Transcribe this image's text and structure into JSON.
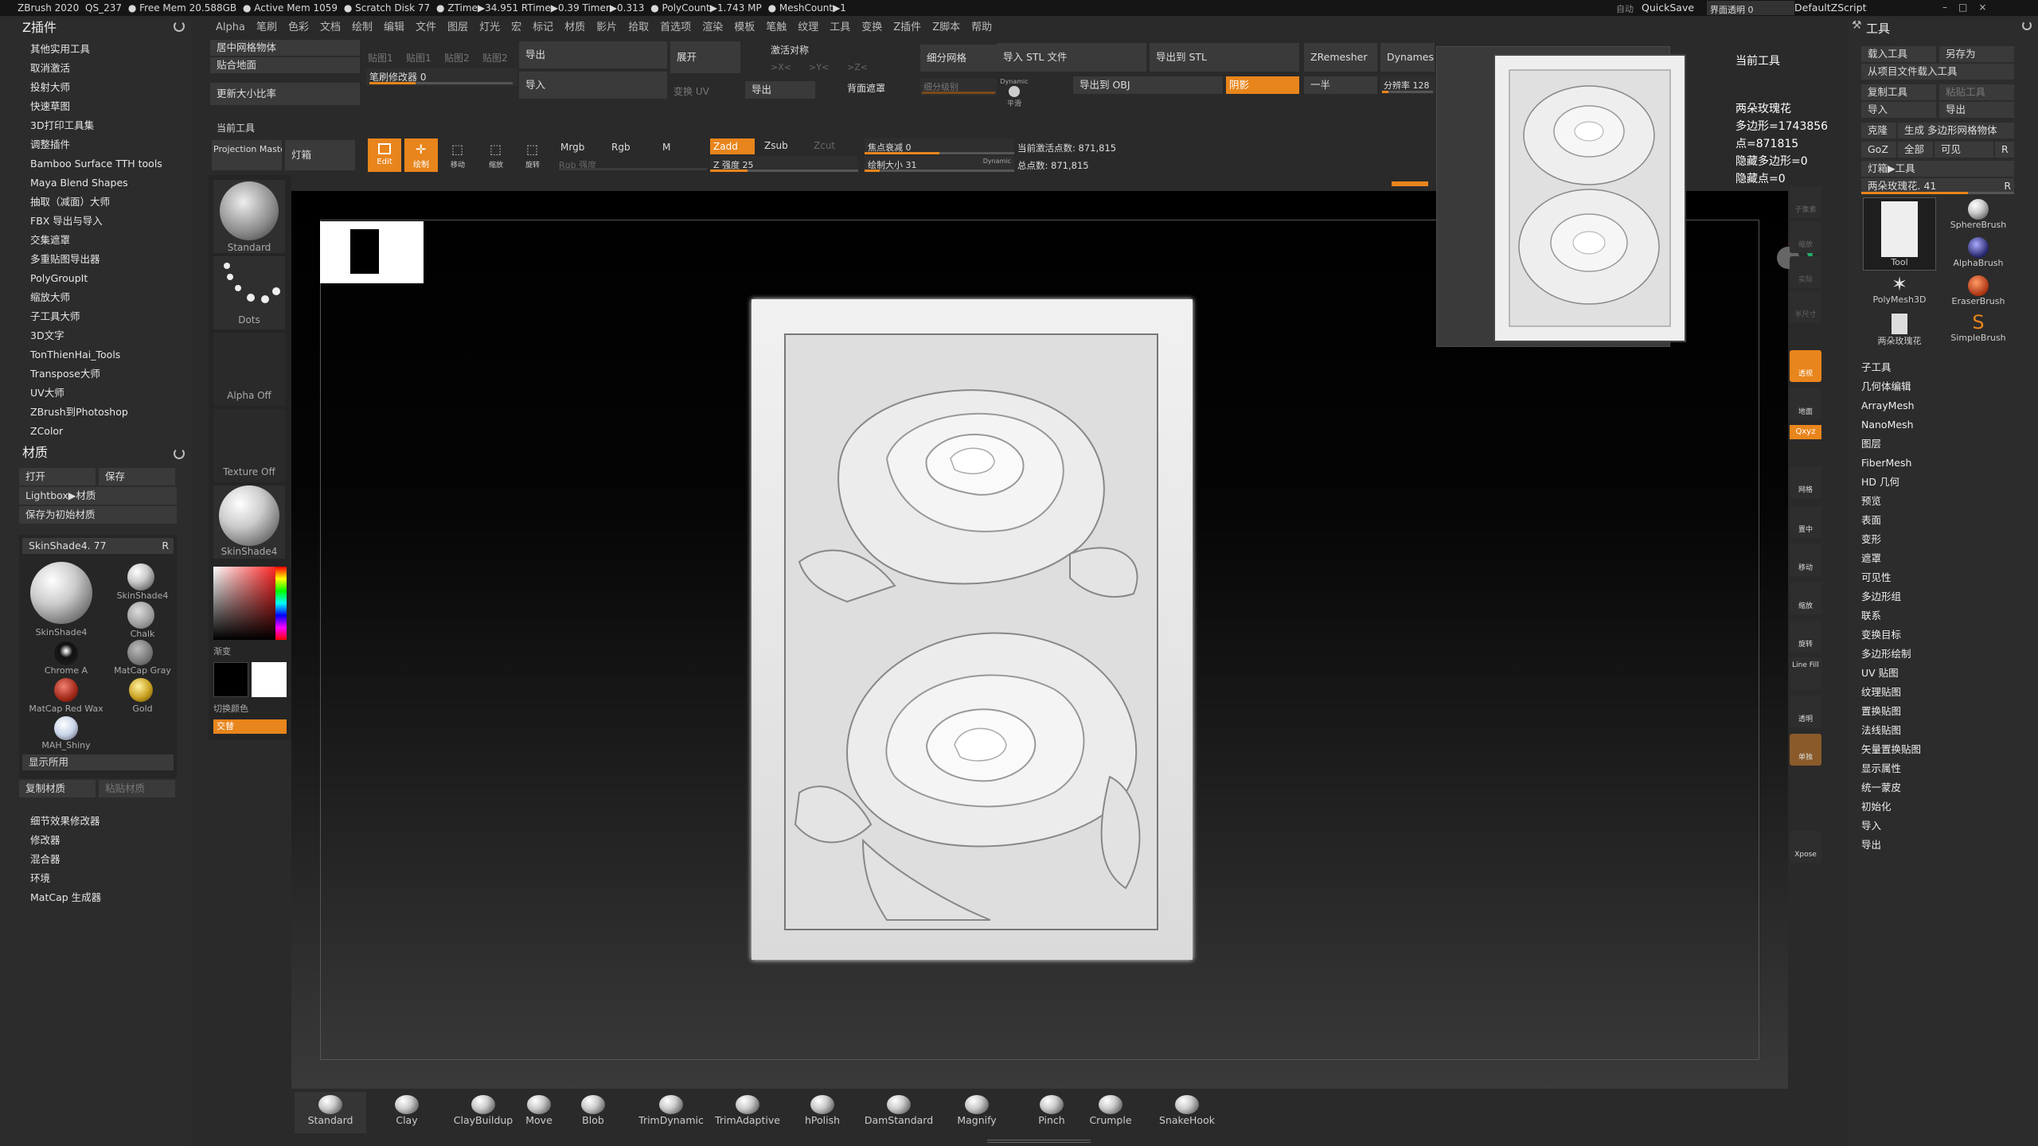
{
  "titlebar": {
    "items": [
      "ZBrush 2020",
      "QS_237",
      "● Free Mem 20.588GB",
      "● Active Mem 1059",
      "● Scratch Disk 77",
      "● ZTime▶34.951 RTime▶0.39 Timer▶0.313",
      "● PolyCount▶1.743 MP",
      "● MeshCount▶1"
    ],
    "auto": "自动",
    "quicksave": "QuickSave",
    "transparency": "界面透明 0",
    "script": "DefaultZScript"
  },
  "menu": [
    "Alpha",
    "笔刷",
    "色彩",
    "文档",
    "绘制",
    "编辑",
    "文件",
    "图层",
    "灯光",
    "宏",
    "标记",
    "材质",
    "影片",
    "拾取",
    "首选项",
    "渲染",
    "模板",
    "笔触",
    "纹理",
    "工具",
    "变换",
    "Z插件",
    "Z脚本",
    "帮助"
  ],
  "left": {
    "zplugin_title": "Z插件",
    "plugins": [
      "其他实用工具",
      "取消激活",
      "投射大师",
      "快速草图",
      "3D打印工具集",
      "调整插件",
      "Bamboo Surface TTH tools",
      "Maya Blend Shapes",
      "抽取（减面）大师",
      "FBX 导出与导入",
      "交集遮罩",
      "多重贴图导出器",
      "PolyGroupIt",
      "缩放大师",
      "子工具大师",
      "3D文字",
      "TonThienHai_Tools",
      "Transpose大师",
      "UV大师",
      "ZBrush到Photoshop",
      "ZColor"
    ],
    "material_title": "材质",
    "open": "打开",
    "save": "保存",
    "lightbox": "Lightbox▶材质",
    "save_init": "保存为初始材质",
    "current_mat": "SkinShade4. 77",
    "r": "R",
    "materials": [
      "SkinShade4",
      "Chalk",
      "Chrome A",
      "MatCap Gray",
      "MatCap Red Wax",
      "Gold",
      "MAH_Shiny"
    ],
    "big_mat": "SkinShade4",
    "show_used": "显示所用",
    "copy_mat": "复制材质",
    "paste_mat": "粘贴材质",
    "bottom": [
      "细节效果修改器",
      "修改器",
      "混合器",
      "环境",
      "MatCap 生成器"
    ]
  },
  "shelf": {
    "brush": "Standard",
    "stroke": "Dots",
    "alpha": "Alpha Off",
    "texture": "Texture Off",
    "material": "SkinShade4",
    "gradient": "渐变",
    "switch": "切换颜色",
    "alternate": "交替"
  },
  "top": {
    "center_mesh": "居中网格物体",
    "fit_ground": "贴合地面",
    "update_scale": "更新大小比率",
    "tex": [
      "贴图1",
      "贴图1",
      "贴图2",
      "贴图2"
    ],
    "brush_mod": "笔刷修改器 0",
    "export": "导出",
    "import": "导入",
    "expand": "展开",
    "uv": "变换 UV",
    "export2": "导出",
    "activate_sym": "激活对称",
    "x": ">X<",
    "y": ">Y<",
    "z": ">Z<",
    "back_mask": "背面遮罩",
    "subdiv": "细分网格",
    "subdiv_level": "细分级别",
    "dynamic": "Dynamic",
    "smooth": "平滑",
    "import_stl": "导入 STL 文件",
    "export_obj": "导出到 OBJ",
    "export_stl": "导出到 STL",
    "shadow": "阴影",
    "zremesher": "ZRemesher",
    "half": "一半",
    "dynamesh": "Dynamesh",
    "resolution": "分辨率 128",
    "current_tool": "当前工具",
    "projection": "Projection Master",
    "lightbox": "灯箱",
    "edit": "Edit",
    "draw": "绘制",
    "move": "移动",
    "scale": "缩放",
    "rotate": "旋转",
    "mrgb": "Mrgb",
    "rgb": "Rgb",
    "m": "M",
    "rgb_int": "Rgb 强度",
    "zadd": "Zadd",
    "zsub": "Zsub",
    "zcut": "Zcut",
    "z_int": "Z 强度 25",
    "focal": "焦点衰减 0",
    "draw_size": "绘制大小 31",
    "dynamic2": "Dynamic",
    "active_pts": "当前激活点数: 871,815",
    "total_pts": "总点数: 871,815"
  },
  "popup": {
    "title": "当前工具",
    "name": "两朵玫瑰花",
    "polys": "多边形=1743856",
    "points": "点=871815",
    "hidden_polys": "隐藏多边形=0",
    "hidden_pts": "隐藏点=0"
  },
  "right": {
    "title": "工具",
    "load": "载入工具",
    "save_as": "另存为",
    "load_proj": "从项目文件载入工具",
    "copy_tool": "复制工具",
    "paste_tool": "粘贴工具",
    "import": "导入",
    "export": "导出",
    "clone": "克隆",
    "make_poly": "生成 多边形网格物体",
    "goz": "GoZ",
    "all": "全部",
    "visible": "可见",
    "r": "R",
    "lightbox_tool": "灯箱▶工具",
    "tool_name": "两朵玫瑰花. 41",
    "tools": [
      "Tool",
      "SphereBrush",
      "AlphaBrush",
      "PolyMesh3D",
      "EraserBrush",
      "两朵玫瑰花",
      "SimpleBrush"
    ],
    "sections": [
      "子工具",
      "几何体编辑",
      "ArrayMesh",
      "NanoMesh",
      "图层",
      "FiberMesh",
      "HD 几何",
      "预览",
      "表面",
      "变形",
      "遮罩",
      "可见性",
      "多边形组",
      "联系",
      "变换目标",
      "多边形绘制",
      "UV 贴图",
      "纹理贴图",
      "置换贴图",
      "法线贴图",
      "矢量置换贴图",
      "显示属性",
      "统一蒙皮",
      "初始化",
      "导入",
      "导出"
    ]
  },
  "vbar": [
    "子像素",
    "缩放",
    "实际",
    "半尺寸",
    "透视",
    "地面",
    "网格",
    "置中",
    "移动",
    "缩放",
    "旋转",
    "Line Fill",
    "透明",
    "单独",
    "Xpose"
  ],
  "bottom_brushes": [
    "Standard",
    "Clay",
    "ClayBuildup",
    "Move",
    "Blob",
    "TrimDynamic",
    "TrimAdaptive",
    "hPolish",
    "DamStandard",
    "Magnify",
    "Pinch",
    "Crumple",
    "SnakeHook"
  ],
  "colors": {
    "accent": "#e8851c"
  }
}
